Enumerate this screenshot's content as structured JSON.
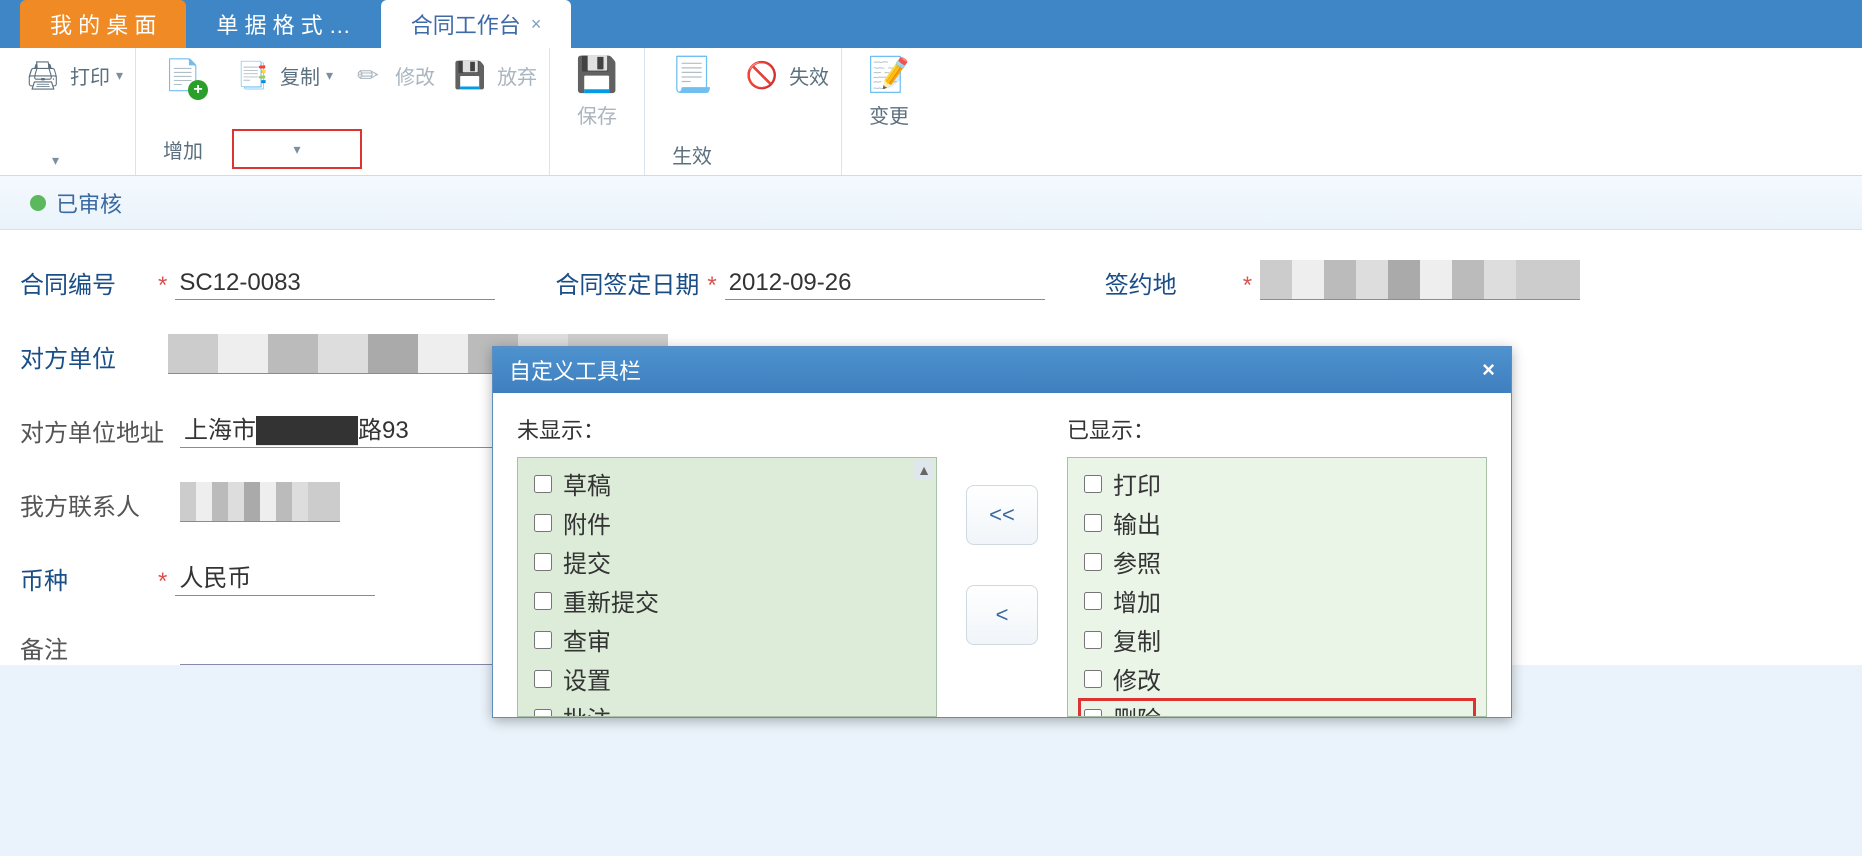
{
  "tabs": [
    {
      "label": "我 的 桌 面",
      "kind": "orange"
    },
    {
      "label": "单 据 格 式 …",
      "kind": "blue"
    },
    {
      "label": "合同工作台",
      "kind": "white"
    }
  ],
  "toolbar": {
    "print": "打印",
    "add": "增加",
    "copy": "复制",
    "modify": "修改",
    "discard": "放弃",
    "save": "保存",
    "effect": "生效",
    "invalid": "失效",
    "change": "变更"
  },
  "status": {
    "text": "已审核"
  },
  "form": {
    "contract_no_label": "合同编号",
    "contract_no": "SC12-0083",
    "sign_date_label": "合同签定日期",
    "sign_date": "2012-09-26",
    "sign_place_label": "签约地",
    "sign_place": "（已隐藏）",
    "other_party_label": "对方单位",
    "other_party": "（已隐藏）",
    "other_addr_label": "对方单位地址",
    "other_addr": "上海市██████路93",
    "our_contact_label": "我方联系人",
    "our_contact": "（已隐藏）",
    "currency_label": "币种",
    "currency": "人民币",
    "remark_label": "备注",
    "remark": ""
  },
  "dialog": {
    "title": "自定义工具栏",
    "left_header": "未显示：",
    "right_header": "已显示：",
    "move_all_left": "<<",
    "move_left": "<",
    "left_items": [
      "草稿",
      "附件",
      "提交",
      "重新提交",
      "查审",
      "设置",
      "批注"
    ],
    "right_items": [
      "打印",
      "输出",
      "参照",
      "增加",
      "复制",
      "修改",
      "删除"
    ]
  }
}
